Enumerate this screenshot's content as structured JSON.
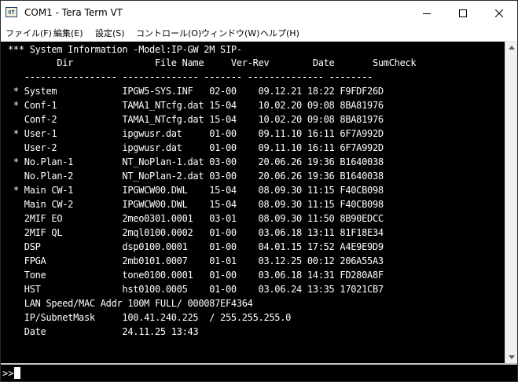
{
  "window": {
    "title": "COM1 - Tera Term VT",
    "icon_text": "VT"
  },
  "menu": [
    {
      "name": "file",
      "label": "ファイル(F)"
    },
    {
      "name": "edit",
      "label": "編集(E)"
    },
    {
      "name": "setup",
      "label": "設定(S)"
    },
    {
      "name": "control",
      "label": "コントロール(O)"
    },
    {
      "name": "window",
      "label": "ウィンドウ(W)"
    },
    {
      "name": "help",
      "label": "ヘルプ(H)"
    }
  ],
  "terminal": {
    "lines": [
      "*** System Information -Model:IP-GW 2M SIP-",
      "         Dir               File Name     Ver-Rev        Date       SumCheck",
      "   ----------------- -------------- ------- -------------- --------",
      " * System            IPGW5-SYS.INF   02-00    09.12.21 18:22 F9FDF26D",
      " * Conf-1            TAMA1_NTcfg.dat 15-04    10.02.20 09:08 8BA81976",
      "   Conf-2            TAMA1_NTcfg.dat 15-04    10.02.20 09:08 8BA81976",
      " * User-1            ipgwusr.dat     01-00    09.11.10 16:11 6F7A992D",
      "   User-2            ipgwusr.dat     01-00    09.11.10 16:11 6F7A992D",
      " * No.Plan-1         NT_NoPlan-1.dat 03-00    20.06.26 19:36 B1640038",
      "   No.Plan-2         NT_NoPlan-2.dat 03-00    20.06.26 19:36 B1640038",
      " * Main CW-1         IPGWCW00.DWL    15-04    08.09.30 11:15 F40CB098",
      "   Main CW-2         IPGWCW00.DWL    15-04    08.09.30 11:15 F40CB098",
      "   2MIF EO           2meo0301.0001   03-01    08.09.30 11:50 8B90EDCC",
      "   2MIF QL           2mql0100.0002   01-00    03.06.18 13:11 81F18E34",
      "   DSP               dsp0100.0001    01-00    04.01.15 17:52 A4E9E9D9",
      "   FPGA              2mb0101.0007    01-01    03.12.25 00:12 206A55A3",
      "   Tone              tone0100.0001   01-00    03.06.18 14:31 FD280A8F",
      "   HST               hst0100.0005    01-00    03.06.24 13:35 17021CB7",
      "   LAN Speed/MAC Addr 100M FULL/ 000087EF4364",
      "   IP/SubnetMask     100.41.240.225  / 255.255.255.0",
      "   Date              24.11.25 13:43"
    ]
  },
  "command": {
    "prompt": ">>"
  }
}
